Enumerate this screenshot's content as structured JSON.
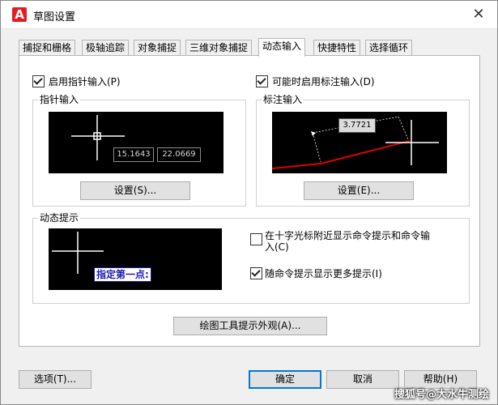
{
  "window": {
    "title": "草图设置",
    "close_glyph": "✕"
  },
  "tabs": [
    {
      "label": "捕捉和栅格"
    },
    {
      "label": "极轴追踪"
    },
    {
      "label": "对象捕捉"
    },
    {
      "label": "三维对象捕捉"
    },
    {
      "label": "动态输入",
      "active": true
    },
    {
      "label": "快捷特性"
    },
    {
      "label": "选择循环"
    }
  ],
  "pointer_input": {
    "enable_label": "启用指针输入(P)",
    "enable_checked": true,
    "group_title": "指针输入",
    "readout_x": "15.1643",
    "readout_y": "22.0669",
    "settings_button": "设置(S)..."
  },
  "dimension_input": {
    "enable_label": "可能时启用标注输入(D)",
    "enable_checked": true,
    "group_title": "标注输入",
    "readout": "3.7721",
    "settings_button": "设置(E)..."
  },
  "dynamic_prompts": {
    "group_title": "动态提示",
    "prompt_text": "指定第一点:",
    "option1_label_line1": "在十字光标附近显示命令提示和命令输",
    "option1_label_line2": "入(C)",
    "option1_checked": false,
    "option2_label": "随命令提示显示更多提示(I)",
    "option2_checked": true
  },
  "drafting_tooltip_button": "绘图工具提示外观(A)...",
  "footer": {
    "options_button": "选项(T)...",
    "ok_button": "确定",
    "cancel_button": "取消",
    "help_button": "帮助(H)"
  },
  "watermark": "搜狐号@大水牛测绘",
  "colors": {
    "accent": "#0078d7",
    "preview_bg": "#000000",
    "dimension_line": "#e00000"
  },
  "icons": {
    "app": "autocad-a-icon",
    "close": "close-icon"
  }
}
